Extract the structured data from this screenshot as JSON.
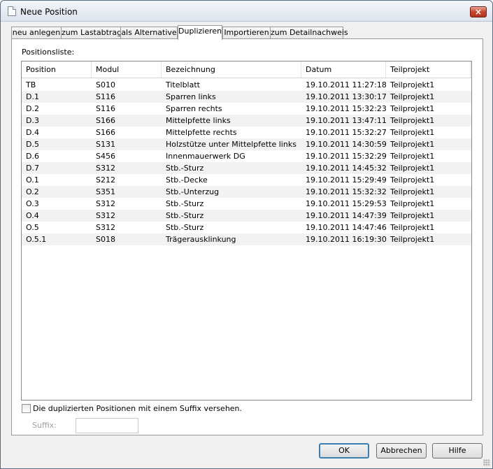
{
  "window": {
    "title": "Neue Position",
    "close_label": "×"
  },
  "tabs": [
    {
      "label": "neu anlegen"
    },
    {
      "label": "zum Lastabtrag"
    },
    {
      "label": "als Alternative"
    },
    {
      "label": "Duplizieren"
    },
    {
      "label": "Importieren"
    },
    {
      "label": "zum Detailnachweis"
    }
  ],
  "active_tab": "Duplizieren",
  "list": {
    "caption": "Positionsliste:",
    "columns": [
      "Position",
      "Modul",
      "Bezeichnung",
      "Datum",
      "Teilprojekt"
    ],
    "rows": [
      [
        "TB",
        "S010",
        "Titelblatt",
        "19.10.2011 11:27:18",
        "Teilprojekt1"
      ],
      [
        "D.1",
        "S116",
        "Sparren links",
        "19.10.2011 13:30:17",
        "Teilprojekt1"
      ],
      [
        "D.2",
        "S116",
        "Sparren rechts",
        "19.10.2011 15:32:23",
        "Teilprojekt1"
      ],
      [
        "D.3",
        "S166",
        "Mittelpfette links",
        "19.10.2011 13:47:11",
        "Teilprojekt1"
      ],
      [
        "D.4",
        "S166",
        "Mittelpfette rechts",
        "19.10.2011 15:32:27",
        "Teilprojekt1"
      ],
      [
        "D.5",
        "S131",
        "Holzstütze unter Mittelpfette links",
        "19.10.2011 14:30:59",
        "Teilprojekt1"
      ],
      [
        "D.6",
        "S456",
        "Innenmauerwerk DG",
        "19.10.2011 15:32:29",
        "Teilprojekt1"
      ],
      [
        "D.7",
        "S312",
        "Stb.-Sturz",
        "19.10.2011 14:45:32",
        "Teilprojekt1"
      ],
      [
        "O.1",
        "S212",
        "Stb.-Decke",
        "19.10.2011 15:29:49",
        "Teilprojekt1"
      ],
      [
        "O.2",
        "S351",
        "Stb.-Unterzug",
        "19.10.2011 15:32:32",
        "Teilprojekt1"
      ],
      [
        "O.3",
        "S312",
        "Stb.-Sturz",
        "19.10.2011 15:29:53",
        "Teilprojekt1"
      ],
      [
        "O.4",
        "S312",
        "Stb.-Sturz",
        "19.10.2011 14:47:39",
        "Teilprojekt1"
      ],
      [
        "O.5",
        "S312",
        "Stb.-Sturz",
        "19.10.2011 14:47:46",
        "Teilprojekt1"
      ],
      [
        "O.5.1",
        "S018",
        "Trägerausklinkung",
        "19.10.2011 16:19:30",
        "Teilprojekt1"
      ]
    ]
  },
  "suffix": {
    "checkbox_label": "Die duplizierten Positionen mit einem Suffix versehen.",
    "checked": false,
    "field_label": "Suffix:",
    "value": ""
  },
  "buttons": {
    "ok": "OK",
    "cancel": "Abbrechen",
    "help": "Hilfe"
  }
}
